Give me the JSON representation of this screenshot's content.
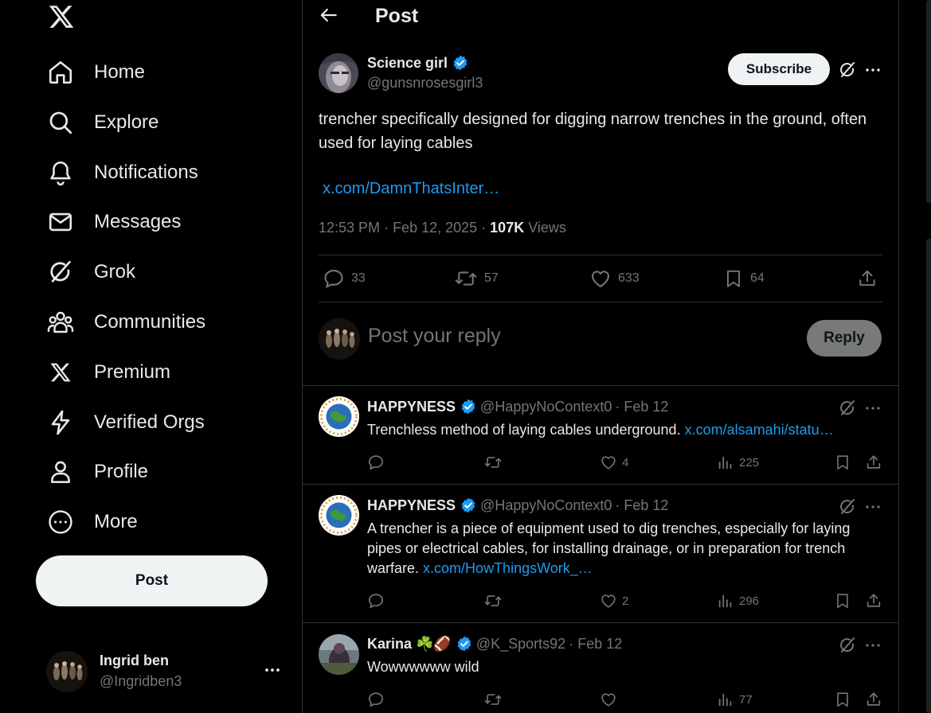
{
  "sidebar": {
    "nav": [
      {
        "label": "Home",
        "icon": "home-icon"
      },
      {
        "label": "Explore",
        "icon": "search-icon"
      },
      {
        "label": "Notifications",
        "icon": "bell-icon"
      },
      {
        "label": "Messages",
        "icon": "envelope-icon"
      },
      {
        "label": "Grok",
        "icon": "grok-icon"
      },
      {
        "label": "Communities",
        "icon": "people-icon"
      },
      {
        "label": "Premium",
        "icon": "x-logo-icon"
      },
      {
        "label": "Verified Orgs",
        "icon": "lightning-icon"
      },
      {
        "label": "Profile",
        "icon": "person-icon"
      },
      {
        "label": "More",
        "icon": "more-circle-icon"
      }
    ],
    "post_label": "Post",
    "account": {
      "name": "Ingrid ben",
      "handle": "@Ingridben3"
    }
  },
  "header": {
    "title": "Post"
  },
  "post": {
    "author": {
      "name": "Science girl",
      "handle": "@gunsnrosesgirl3",
      "verified": true
    },
    "subscribe_label": "Subscribe",
    "text": "trencher specifically designed for digging narrow trenches in the ground, often used for laying cables",
    "link": "x.com/DamnThatsInter…",
    "time": "12:53 PM",
    "date": "Feb 12, 2025",
    "views": "107K",
    "views_label": "Views",
    "stats": {
      "replies": "33",
      "reposts": "57",
      "likes": "633",
      "bookmarks": "64"
    }
  },
  "reply_box": {
    "placeholder": "Post your reply",
    "button": "Reply"
  },
  "replies": [
    {
      "name": "HAPPYNESS",
      "handle": "@HappyNoContext0",
      "date": "· Feb 12",
      "text": "Trenchless method of laying cables underground.",
      "link": "x.com/alsamahi/statu…",
      "likes": "4",
      "views": "225"
    },
    {
      "name": "HAPPYNESS",
      "handle": "@HappyNoContext0",
      "date": "· Feb 12",
      "text": "A trencher is a piece of equipment used to dig trenches, especially for laying pipes or electrical cables, for installing drainage, or in preparation for trench warfare.",
      "link": "x.com/HowThingsWork_…",
      "likes": "2",
      "views": "296"
    },
    {
      "name": "Karina ☘️🏈",
      "handle": "@K_Sports92",
      "date": "· Feb 12",
      "text": "Wowwwwww wild",
      "link": "",
      "likes": "",
      "views": "77"
    }
  ],
  "colors": {
    "background": "#000000",
    "text": "#e7e9ea",
    "muted": "#71767b",
    "accent": "#1d9bf0",
    "border": "#2f3336"
  }
}
